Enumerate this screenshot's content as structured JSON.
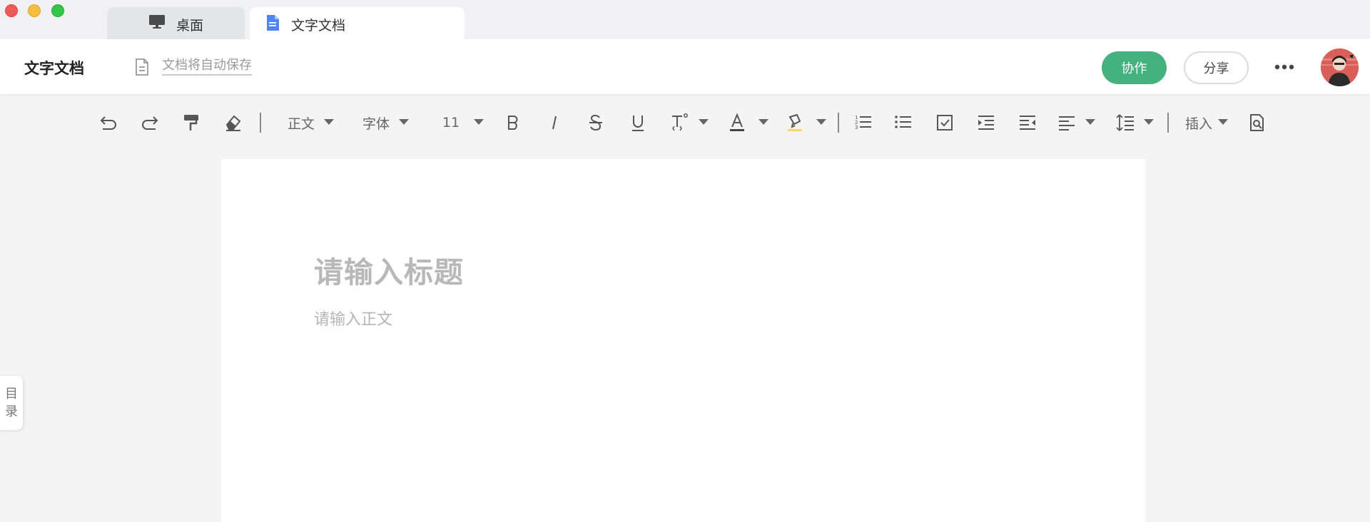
{
  "window": {
    "tabs": [
      {
        "label": "桌面",
        "icon": "monitor-icon",
        "active": false
      },
      {
        "label": "文字文档",
        "icon": "document-icon",
        "active": true
      }
    ]
  },
  "header": {
    "title": "文字文档",
    "autosave_text": "文档将自动保存",
    "collab_label": "协作",
    "share_label": "分享",
    "colors": {
      "collab": "#44b17f"
    }
  },
  "toolbar": {
    "paragraph_style": "正文",
    "font_family": "字体",
    "font_size": "11",
    "insert_label": "插入",
    "icons": [
      "undo-icon",
      "redo-icon",
      "format-painter-icon",
      "eraser-icon",
      "bold-icon",
      "italic-icon",
      "strikethrough-icon",
      "underline-icon",
      "superscript-icon",
      "font-color-icon",
      "highlight-icon",
      "ordered-list-icon",
      "unordered-list-icon",
      "checklist-icon",
      "indent-increase-icon",
      "indent-decrease-icon",
      "align-icon",
      "line-spacing-icon",
      "find-icon"
    ]
  },
  "document": {
    "title_placeholder": "请输入标题",
    "body_placeholder": "请输入正文"
  },
  "outline": {
    "label_line1": "目",
    "label_line2": "录"
  }
}
